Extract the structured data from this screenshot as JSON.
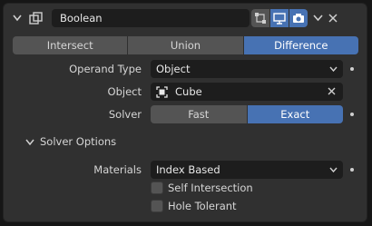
{
  "modifier": {
    "name": "Boolean",
    "icons": {
      "collapse": "chevron-down-icon",
      "type": "boolean-modifier-icon",
      "editmode": "edit-mode-icon",
      "viewport": "viewport-display-icon",
      "render": "render-camera-icon",
      "menu": "chevron-down-icon",
      "remove": "close-icon"
    }
  },
  "operation": {
    "options": [
      "Intersect",
      "Union",
      "Difference"
    ],
    "selected": "Difference"
  },
  "operand_type": {
    "label": "Operand Type",
    "value": "Object"
  },
  "object": {
    "label": "Object",
    "value": "Cube"
  },
  "solver": {
    "label": "Solver",
    "options": [
      "Fast",
      "Exact"
    ],
    "selected": "Exact"
  },
  "solver_options": {
    "title": "Solver Options",
    "materials": {
      "label": "Materials",
      "value": "Index Based"
    },
    "self_intersection": {
      "label": "Self Intersection",
      "checked": false
    },
    "hole_tolerant": {
      "label": "Hole Tolerant",
      "checked": false
    }
  },
  "colors": {
    "accent": "#4772b3",
    "panel": "#303030",
    "field": "#1d1d1d",
    "button": "#545454"
  }
}
